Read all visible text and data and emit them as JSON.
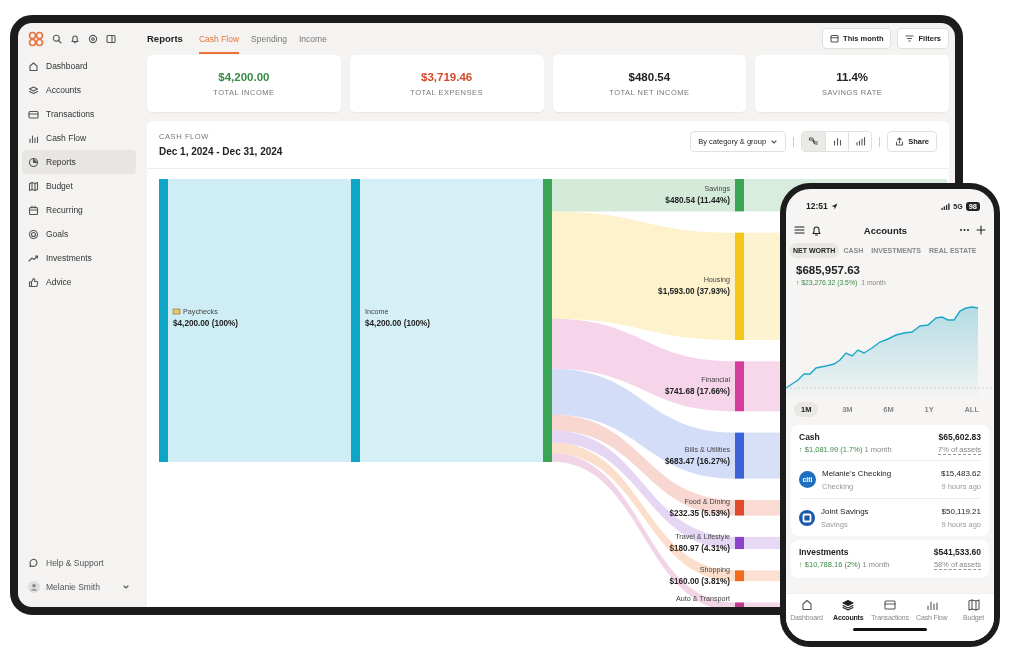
{
  "sidebar": {
    "nav_items": [
      {
        "label": "Dashboard",
        "selected": false
      },
      {
        "label": "Accounts",
        "selected": false
      },
      {
        "label": "Transactions",
        "selected": false
      },
      {
        "label": "Cash Flow",
        "selected": false
      },
      {
        "label": "Reports",
        "selected": true
      },
      {
        "label": "Budget",
        "selected": false
      },
      {
        "label": "Recurring",
        "selected": false
      },
      {
        "label": "Goals",
        "selected": false
      },
      {
        "label": "Investments",
        "selected": false
      },
      {
        "label": "Advice",
        "selected": false
      }
    ],
    "help": "Help & Support",
    "user": "Melanie Smith"
  },
  "header": {
    "title": "Reports",
    "tabs": [
      {
        "label": "Cash Flow",
        "selected": true
      },
      {
        "label": "Spending",
        "selected": false
      },
      {
        "label": "Income",
        "selected": false
      }
    ],
    "buttons": [
      "This month",
      "Filters"
    ]
  },
  "summary_cards": [
    {
      "value": "$4,200.00",
      "label": "TOTAL INCOME",
      "color": "#3a8a48"
    },
    {
      "value": "$3,719.46",
      "label": "TOTAL EXPENSES",
      "color": "#d2492a"
    },
    {
      "value": "$480.54",
      "label": "TOTAL NET INCOME",
      "color": "#222222"
    },
    {
      "value": "11.4%",
      "label": "SAVINGS RATE",
      "color": "#222222"
    }
  ],
  "cash_flow": {
    "heading": "CASH FLOW",
    "date_range": "Dec 1, 2024 - Dec 31, 2024",
    "group_by": "By category & group",
    "view_buttons": [
      {
        "selected": true
      },
      {
        "selected": false
      },
      {
        "selected": false
      }
    ],
    "share": "Share",
    "sankey": {
      "source": {
        "label": "Paychecks",
        "amount": "$4,200.00 (100%)",
        "color": "#0ea5c6"
      },
      "hub": {
        "label": "Income",
        "amount": "$4,200.00 (100%)",
        "color": "#0ea5c6"
      },
      "total": {
        "color": "#3aa655"
      },
      "categories": [
        {
          "label": "Savings",
          "amount": "$480.54 (11.44%)",
          "level": 0.1144,
          "color": "#3aa655"
        },
        {
          "label": "Housing",
          "amount": "$1,593.00 (37.93%)",
          "level": 0.3793,
          "color": "#f5c518"
        },
        {
          "label": "Financial",
          "amount": "$741.68 (17.66%)",
          "level": 0.1766,
          "color": "#d63c9a"
        },
        {
          "label": "Bills & Utilities",
          "amount": "$683.47 (16.27%)",
          "level": 0.1627,
          "color": "#3b62d9"
        },
        {
          "label": "Food & Dining",
          "amount": "$232.35 (5.53%)",
          "level": 0.0553,
          "color": "#e04a2a"
        },
        {
          "label": "Travel & Lifestyle",
          "amount": "$180.97 (4.31%)",
          "level": 0.0431,
          "color": "#8a44cc"
        },
        {
          "label": "Shopping",
          "amount": "$160.00 (3.81%)",
          "level": 0.0381,
          "color": "#f26b1d"
        },
        {
          "label": "Auto & Transport",
          "level": 0.03,
          "color": "#c0398a"
        }
      ]
    }
  },
  "phone": {
    "status_bar": {
      "time": "12:51",
      "network": "5G",
      "battery": "98"
    },
    "title": "Accounts",
    "segments": [
      {
        "label": "NET WORTH",
        "selected": true
      },
      {
        "label": "CASH",
        "selected": false
      },
      {
        "label": "INVESTMENTS",
        "selected": false
      },
      {
        "label": "REAL ESTATE",
        "selected": false
      }
    ],
    "net_worth": "$685,957.63",
    "change": "↑ $23,276.32 (3.5%)",
    "change_period": "1 month",
    "ranges": [
      {
        "label": "1M",
        "selected": true
      },
      {
        "label": "3M",
        "selected": false
      },
      {
        "label": "6M",
        "selected": false
      },
      {
        "label": "1Y",
        "selected": false
      },
      {
        "label": "ALL",
        "selected": false
      }
    ],
    "groups": [
      {
        "title": "Cash",
        "total": "$65,602.83",
        "change": "↑ $1,081.99 (1.7%)",
        "period": "1 month",
        "share": "7% of assets",
        "accounts": [
          {
            "name": "Melanie's Checking",
            "type": "Checking",
            "balance": "$15,483.62",
            "updated": "9 hours ago",
            "logo_text": "citi"
          },
          {
            "name": "Joint Savings",
            "type": "Savings",
            "balance": "$50,119.21",
            "updated": "9 hours ago"
          }
        ]
      },
      {
        "title": "Investments",
        "total": "$541,533.60",
        "change": "↑ $10,788.16 (2%)",
        "period": "1 month",
        "share": "58% of assets"
      }
    ],
    "tab_bar": [
      {
        "label": "Dashboard",
        "selected": false
      },
      {
        "label": "Accounts",
        "selected": true
      },
      {
        "label": "Transactions",
        "selected": false
      },
      {
        "label": "Cash Flow",
        "selected": false
      },
      {
        "label": "Budget",
        "selected": false
      }
    ]
  }
}
